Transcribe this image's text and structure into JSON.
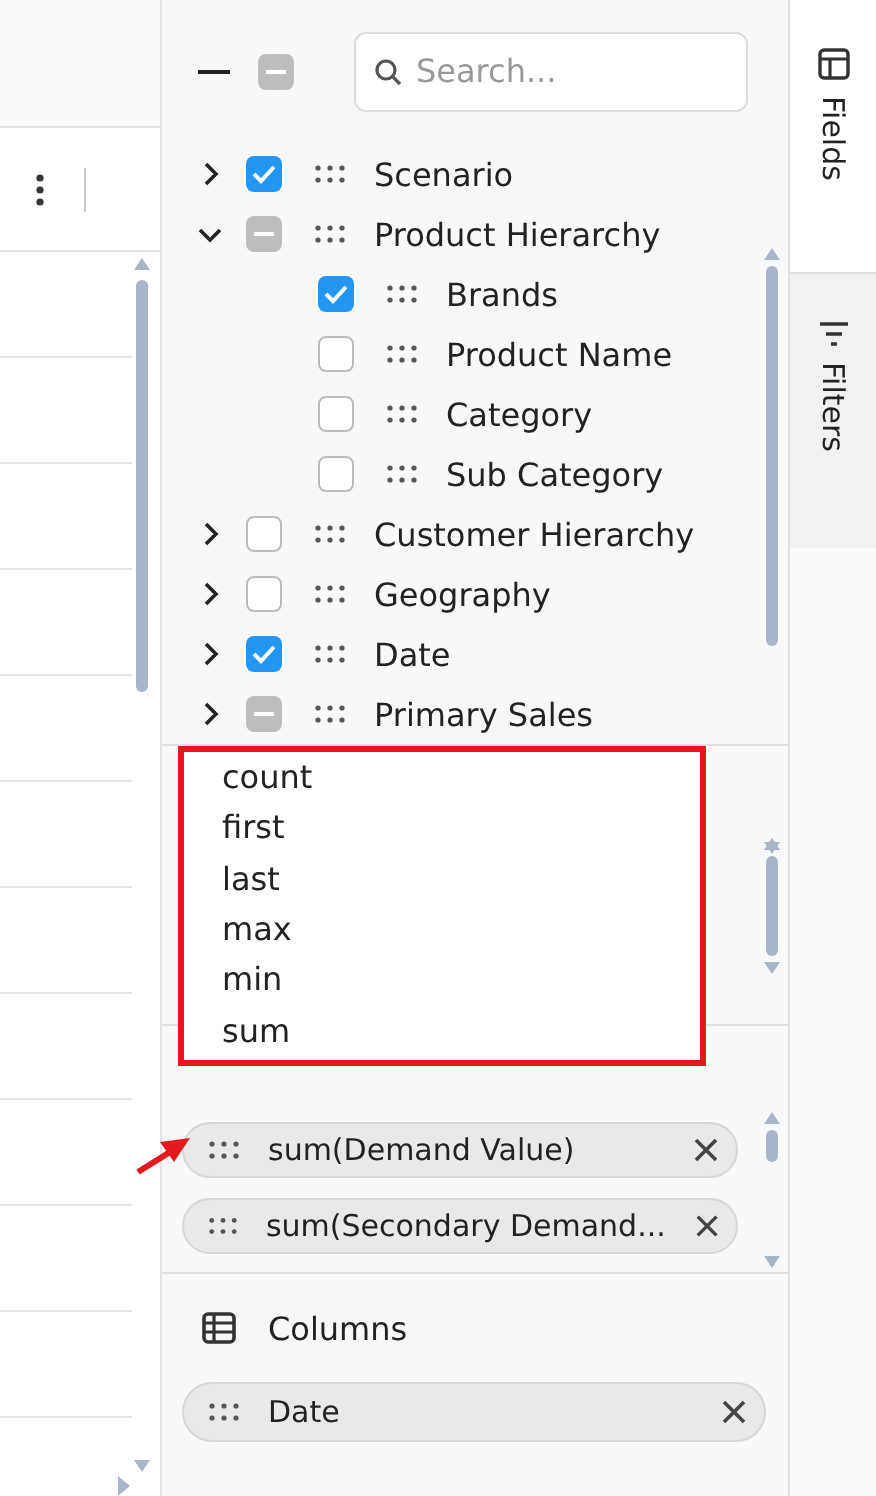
{
  "field_list": {
    "header_check": {
      "checked": false,
      "indeterminate": true
    },
    "search": {
      "placeholder": "Search..."
    },
    "tree": [
      {
        "label": "Scenario",
        "expanded": false,
        "checked": true,
        "indeterminate": false
      },
      {
        "label": "Product Hierarchy",
        "expanded": true,
        "checked": false,
        "indeterminate": true,
        "children": [
          {
            "label": "Brands",
            "checked": true,
            "indeterminate": false
          },
          {
            "label": "Product Name",
            "checked": false,
            "indeterminate": false
          },
          {
            "label": "Category",
            "checked": false,
            "indeterminate": false
          },
          {
            "label": "Sub Category",
            "checked": false,
            "indeterminate": false
          }
        ]
      },
      {
        "label": "Customer Hierarchy",
        "expanded": false,
        "checked": false,
        "indeterminate": false
      },
      {
        "label": "Geography",
        "expanded": false,
        "checked": false,
        "indeterminate": false
      },
      {
        "label": "Date",
        "expanded": false,
        "checked": true,
        "indeterminate": false
      },
      {
        "label": "Primary Sales",
        "expanded": false,
        "checked": false,
        "indeterminate": true
      }
    ]
  },
  "aggregate_menu": {
    "options": [
      "count",
      "first",
      "last",
      "max",
      "min",
      "sum"
    ]
  },
  "values": {
    "pills": [
      "sum(Demand Value)",
      "sum(Secondary Demand..."
    ]
  },
  "columns": {
    "title": "Columns",
    "pills": [
      "Date"
    ]
  },
  "side_tabs": [
    {
      "label": "Fields",
      "selected": true
    },
    {
      "label": "Filters",
      "selected": false
    }
  ]
}
